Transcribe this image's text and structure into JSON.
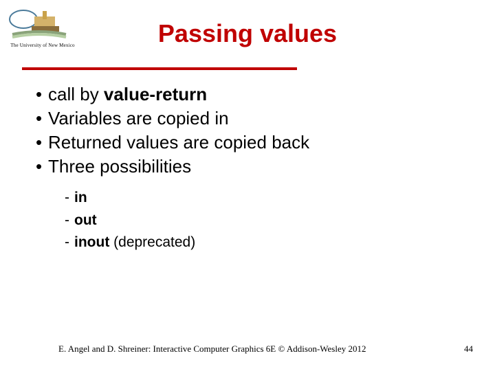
{
  "logo": {
    "caption": "The University of New Mexico"
  },
  "title": "Passing values",
  "bullets": [
    {
      "pre": "call by ",
      "strong": "value-return",
      "post": ""
    },
    {
      "pre": "Variables are copied in",
      "strong": "",
      "post": ""
    },
    {
      "pre": "Returned values are copied back",
      "strong": "",
      "post": ""
    },
    {
      "pre": "Three possibilities",
      "strong": "",
      "post": ""
    }
  ],
  "sublist": [
    {
      "strong": "in",
      "post": ""
    },
    {
      "strong": "out",
      "post": ""
    },
    {
      "strong": "inout",
      "post": " (deprecated)"
    }
  ],
  "footer": {
    "text": "E. Angel and D. Shreiner: Interactive Computer Graphics 6E © Addison-Wesley 2012",
    "page": "44"
  }
}
